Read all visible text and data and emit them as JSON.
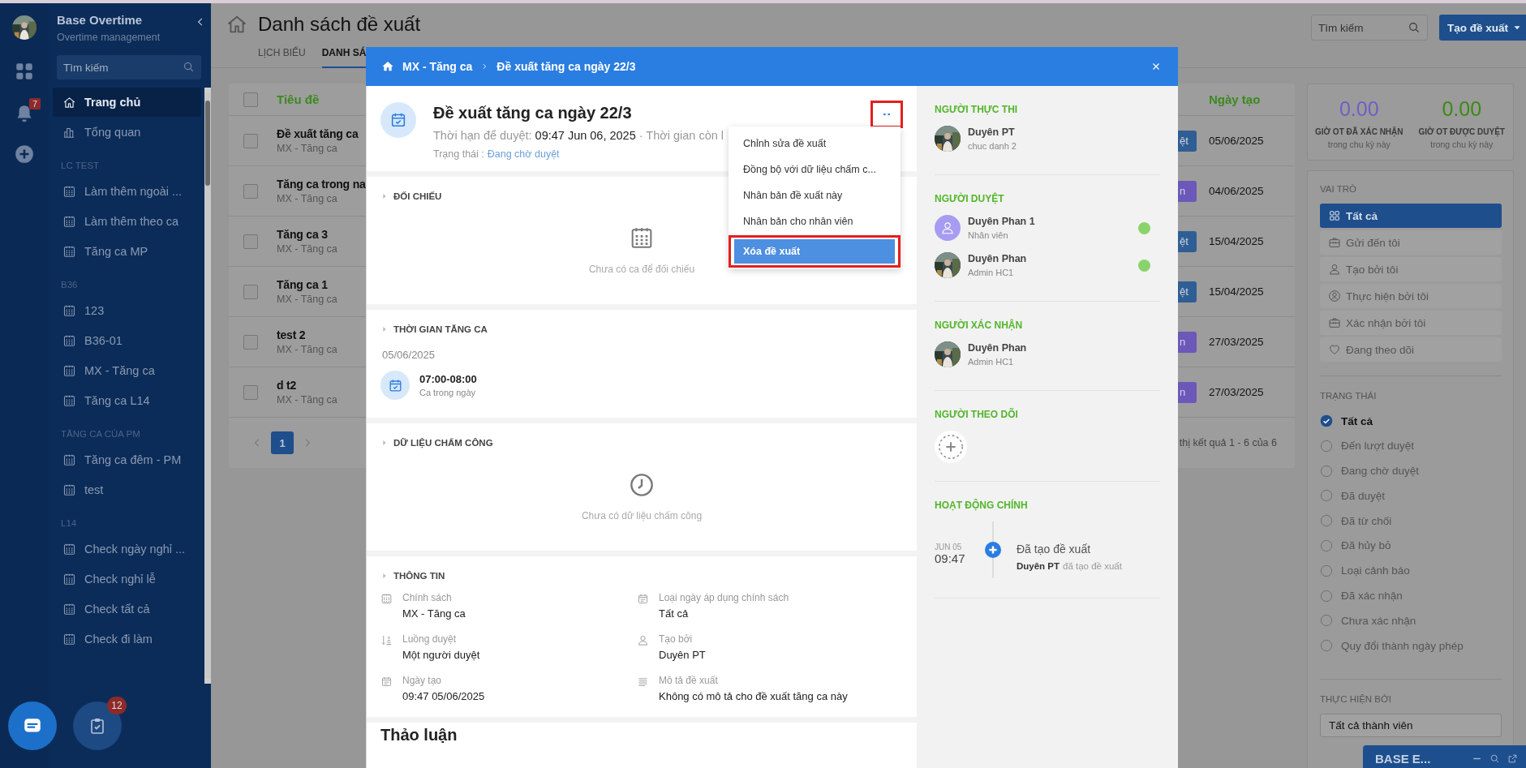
{
  "rail": {
    "notification_count": "7"
  },
  "sidebar": {
    "title": "Base Overtime",
    "subtitle": "Overtime management",
    "search": {
      "placeholder": "Tìm kiếm"
    },
    "items": [
      {
        "label": "Trang chủ",
        "selected": true
      },
      {
        "label": "Tổng quan",
        "selected": false
      }
    ],
    "groups": [
      {
        "title": "LC TEST",
        "items": [
          {
            "label": "Làm thêm ngoài ...",
            "selected": false
          },
          {
            "label": "Làm thêm theo ca",
            "selected": false
          },
          {
            "label": "Tăng ca MP",
            "selected": false
          }
        ]
      },
      {
        "title": "B36",
        "items": [
          {
            "label": "123",
            "selected": false
          },
          {
            "label": "B36-01",
            "selected": false
          },
          {
            "label": "MX - Tăng ca",
            "selected": false
          },
          {
            "label": "Tăng ca L14",
            "selected": false
          }
        ]
      },
      {
        "title": "TĂNG CA CỦA PM",
        "items": [
          {
            "label": "Tăng ca đêm - PM",
            "selected": false
          },
          {
            "label": "test",
            "selected": false
          }
        ]
      },
      {
        "title": "L14",
        "items": [
          {
            "label": "Check ngày nghỉ ...",
            "selected": false
          },
          {
            "label": "Check nghỉ lễ",
            "selected": false
          },
          {
            "label": "Check tất cả",
            "selected": false
          },
          {
            "label": "Check đi làm",
            "selected": false
          }
        ]
      }
    ]
  },
  "floating": {
    "task_count": "12"
  },
  "page": {
    "title": "Danh sách đề xuất",
    "tabs": [
      {
        "label": "LỊCH BIỂU",
        "selected": false
      },
      {
        "label": "DANH SÁ",
        "selected": true
      }
    ],
    "search": {
      "placeholder": "Tìm kiếm"
    },
    "create_button": "Tạo đề xuất"
  },
  "table": {
    "columns": [
      "Tiêu đề",
      "Ngày tạo"
    ],
    "header_checked": false,
    "rows": [
      {
        "title": "Đề xuất tăng ca",
        "subtitle": "MX - Tăng ca",
        "checked": false,
        "status": {
          "text": "ệt",
          "color": "#2f5e94"
        },
        "date": "05/06/2025"
      },
      {
        "title": "Tăng ca trong na",
        "subtitle": "MX - Tăng ca",
        "checked": false,
        "status": {
          "text": "n",
          "color": "#6b58b8"
        },
        "date": "04/06/2025"
      },
      {
        "title": "Tăng ca 3",
        "subtitle": "MX - Tăng ca",
        "checked": false,
        "status": {
          "text": "ệt",
          "color": "#2f5e94"
        },
        "date": "15/04/2025"
      },
      {
        "title": "Tăng ca 1",
        "subtitle": "MX - Tăng ca",
        "checked": false,
        "status": {
          "text": "ệt",
          "color": "#2f5e94"
        },
        "date": "15/04/2025"
      },
      {
        "title": "test 2",
        "subtitle": "MX - Tăng ca",
        "checked": false,
        "status": {
          "text": "n",
          "color": "#6b58b8"
        },
        "date": "27/03/2025"
      },
      {
        "title": "d t2",
        "subtitle": "MX - Tăng ca",
        "checked": false,
        "status": {
          "text": "n",
          "color": "#6b58b8"
        },
        "date": "27/03/2025"
      }
    ],
    "pagination": {
      "pages": [
        {
          "label": "1",
          "selected": true
        }
      ],
      "summary": "thị kết quả 1 - 6 của 6"
    }
  },
  "stats": [
    {
      "value": "0.00",
      "label": "GIỜ OT ĐÃ XÁC NHẬN",
      "note": "trong chu kỳ này",
      "color": "#6f5fc6"
    },
    {
      "value": "0.00",
      "label": "GIỜ OT ĐƯỢC DUYỆT",
      "note": "trong chu kỳ này",
      "color": "#3b8a12"
    }
  ],
  "filters": {
    "roles": {
      "title": "VAI TRÒ",
      "items": [
        {
          "label": "Tất cả",
          "selected": true
        },
        {
          "label": "Gửi đến tôi",
          "selected": false
        },
        {
          "label": "Tạo bởi tôi",
          "selected": false
        },
        {
          "label": "Thực hiện bởi tôi",
          "selected": false
        },
        {
          "label": "Xác nhận bởi tôi",
          "selected": false
        },
        {
          "label": "Đang theo dõi",
          "selected": false
        }
      ]
    },
    "statuses": {
      "title": "TRẠNG THÁI",
      "items": [
        {
          "label": "Tất cả",
          "selected": true
        },
        {
          "label": "Đến lượt duyệt",
          "selected": false
        },
        {
          "label": "Đang chờ duyệt",
          "selected": false
        },
        {
          "label": "Đã duyệt",
          "selected": false
        },
        {
          "label": "Đã từ chối",
          "selected": false
        },
        {
          "label": "Đã hủy bỏ",
          "selected": false
        },
        {
          "label": "Loại cảnh báo",
          "selected": false
        },
        {
          "label": "Đã xác nhận",
          "selected": false
        },
        {
          "label": "Chưa xác nhận",
          "selected": false
        },
        {
          "label": "Quy đổi thành ngày phép",
          "selected": false
        }
      ]
    },
    "performer": {
      "title": "THỰC HIỆN BỞI",
      "value": "Tất cả thành viên"
    }
  },
  "widget": {
    "title": "BASE E..."
  },
  "modal": {
    "breadcrumb": [
      "MX - Tăng ca",
      "Đề xuất tăng ca ngày 22/3"
    ],
    "title": "Đề xuất tăng ca ngày 22/3",
    "deadline_label": "Thời hạn để duyệt:",
    "deadline": "09:47 Jun 06, 2025",
    "remaining": "· Thời gian còn l",
    "status_label": "Trạng thái :",
    "status": "Đang chờ duyệt",
    "menu": [
      {
        "label": "Chỉnh sửa đề xuất",
        "selected": false
      },
      {
        "label": "Đồng bộ với dữ liệu chấm c...",
        "selected": false
      },
      {
        "label": "Nhân bản đề xuất này",
        "selected": false
      },
      {
        "label": "Nhân bản cho nhân viên",
        "selected": false
      },
      {
        "label": "Xóa đề xuất",
        "selected": true
      }
    ],
    "reconciliation": {
      "title": "ĐỐI CHIẾU",
      "empty": "Chưa có ca để đối chiếu"
    },
    "overtime": {
      "title": "THỜI GIAN TĂNG CA",
      "date": "05/06/2025",
      "shifts": [
        {
          "time": "07:00-08:00",
          "name": "Ca trong ngày"
        }
      ]
    },
    "attendance": {
      "title": "DỮ LIỆU CHẤM CÔNG",
      "empty": "Chưa có dữ liệu chấm công"
    },
    "info": {
      "title": "THÔNG TIN",
      "fields": [
        {
          "label": "Chính sách",
          "value": "MX - Tăng ca"
        },
        {
          "label": "Loại ngày áp dụng chính sách",
          "value": "Tất cả"
        },
        {
          "label": "Luồng duyệt",
          "value": "Một người duyệt"
        },
        {
          "label": "Tạo bởi",
          "value": "Duyên PT"
        },
        {
          "label": "Ngày tạo",
          "value": "09:47 05/06/2025"
        },
        {
          "label": "Mô tả đề xuất",
          "value": "Không có mô tả cho đề xuất tăng ca này"
        }
      ]
    },
    "discussion_title": "Thảo luận",
    "executors": {
      "title": "NGƯỜI THỰC THI",
      "people": [
        {
          "name": "Duyên PT",
          "role": "chuc danh 2"
        }
      ]
    },
    "approvers": {
      "title": "NGƯỜI DUYỆT",
      "people": [
        {
          "name": "Duyên Phan 1",
          "role": "Nhân viên",
          "kind": "placeholder",
          "approved": true
        },
        {
          "name": "Duyên Phan",
          "role": "Admin HC1",
          "approved": true
        }
      ]
    },
    "confirmers": {
      "title": "NGƯỜI XÁC NHẬN",
      "people": [
        {
          "name": "Duyên Phan",
          "role": "Admin HC1"
        }
      ]
    },
    "followers": {
      "title": "NGƯỜI THEO DÕI"
    },
    "activity": {
      "title": "HOẠT ĐỘNG CHÍNH",
      "items": [
        {
          "date": "JUN 05",
          "time": "09:47",
          "action": "Đã tạo đề xuất",
          "actor": "Duyên PT",
          "detail": "đã tạo đề xuất"
        }
      ]
    }
  }
}
